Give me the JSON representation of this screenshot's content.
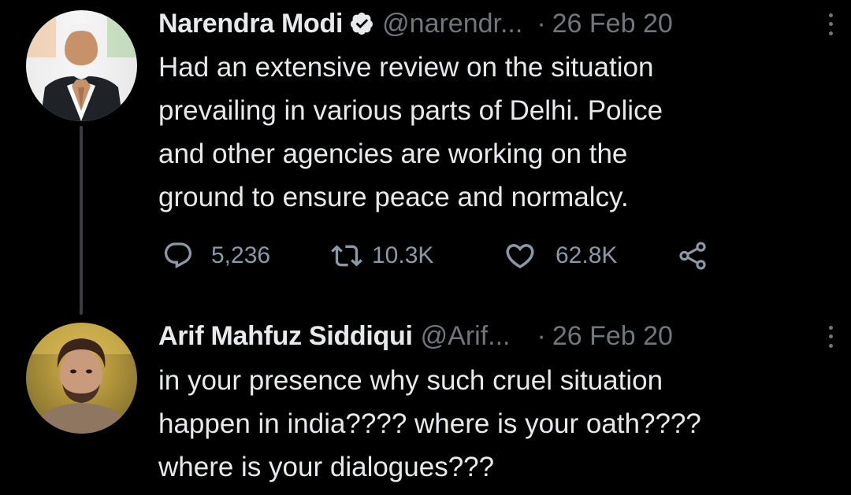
{
  "colors": {
    "background": "#000000",
    "primary_text": "#e7e9ea",
    "secondary_text": "#71767b",
    "action_gray": "#8b98a5",
    "verified_badge": "#e7e9ea"
  },
  "tweets": [
    {
      "name": "Narendra Modi",
      "verified": true,
      "handle": "@narendr...",
      "separator": "·",
      "date": "26 Feb 20",
      "text": "Had an extensive review on the situation\nprevailing in various parts of Delhi. Police\nand other agencies are working on the\nground to ensure peace and normalcy.",
      "actions": {
        "reply": {
          "icon": "reply-icon",
          "count": "5,236"
        },
        "retweet": {
          "icon": "retweet-icon",
          "count": "10.3K"
        },
        "like": {
          "icon": "heart-icon",
          "count": "62.8K"
        },
        "share": {
          "icon": "share-icon"
        }
      }
    },
    {
      "name": "Arif Mahfuz Siddiqui",
      "verified": false,
      "handle": "@Arif...",
      "separator": "·",
      "date": "26 Feb 20",
      "text": "in your presence why such  cruel situation\nhappen in india???? where is your oath????\nwhere is your dialogues???"
    }
  ]
}
